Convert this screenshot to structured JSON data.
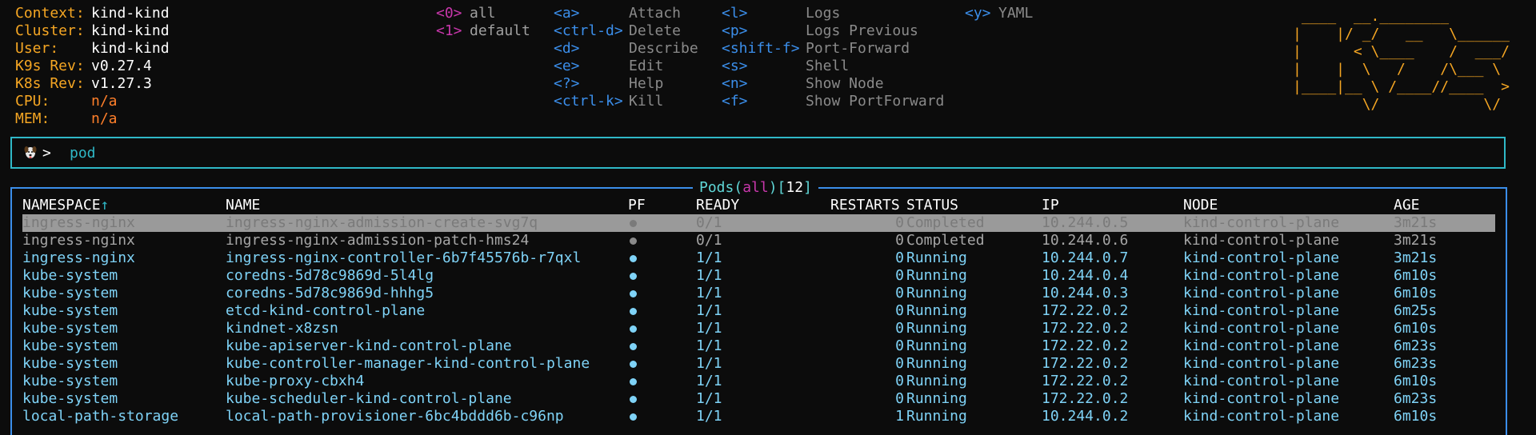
{
  "info": [
    {
      "label": "Context:",
      "value": "kind-kind",
      "na": false
    },
    {
      "label": "Cluster:",
      "value": "kind-kind",
      "na": false
    },
    {
      "label": "User:",
      "value": "kind-kind",
      "na": false
    },
    {
      "label": "K9s Rev:",
      "value": "v0.27.4",
      "na": false
    },
    {
      "label": "K8s Rev:",
      "value": "v1.27.3",
      "na": false
    },
    {
      "label": "CPU:",
      "value": "n/a",
      "na": true
    },
    {
      "label": "MEM:",
      "value": "n/a",
      "na": true
    }
  ],
  "namespaces": [
    {
      "key": "<0>",
      "name": "all"
    },
    {
      "key": "<1>",
      "name": "default"
    }
  ],
  "shortcuts": {
    "col1": [
      {
        "key": "<a>",
        "desc": "Attach"
      },
      {
        "key": "<ctrl-d>",
        "desc": "Delete"
      },
      {
        "key": "<d>",
        "desc": "Describe"
      },
      {
        "key": "<e>",
        "desc": "Edit"
      },
      {
        "key": "<?>",
        "desc": "Help"
      },
      {
        "key": "<ctrl-k>",
        "desc": "Kill"
      }
    ],
    "col2": [
      {
        "key": "<l>",
        "desc": "Logs"
      },
      {
        "key": "<p>",
        "desc": "Logs Previous"
      },
      {
        "key": "<shift-f>",
        "desc": "Port-Forward"
      },
      {
        "key": "<s>",
        "desc": "Shell"
      },
      {
        "key": "<n>",
        "desc": "Show Node"
      },
      {
        "key": "<f>",
        "desc": "Show PortForward"
      }
    ],
    "col3": [
      {
        "key": "<y>",
        "desc": "YAML"
      }
    ]
  },
  "logo_lines": [
    " ____  __.________       ",
    "|    |/ _/   __   \\______",
    "|      < \\____    /  ___/",
    "|    |  \\   /    /\\___ \\ ",
    "|____|__ \\ /____//____  >",
    "        \\/            \\/ "
  ],
  "prompt": {
    "arrow": ">",
    "text": "pod",
    "icon": "dog-icon"
  },
  "table": {
    "resource": "Pods",
    "scope": "all",
    "count": "12",
    "headers": {
      "namespace": "NAMESPACE",
      "sort_arrow": "↑",
      "name": "NAME",
      "pf": "PF",
      "ready": "READY",
      "restarts": "RESTARTS",
      "status": "STATUS",
      "ip": "IP",
      "node": "NODE",
      "age": "AGE"
    },
    "rows": [
      {
        "namespace": "ingress-nginx",
        "name": "ingress-nginx-admission-create-svg7q",
        "ready": "0/1",
        "restarts": "0",
        "status": "Completed",
        "ip": "10.244.0.5",
        "node": "kind-control-plane",
        "age": "3m21s"
      },
      {
        "namespace": "ingress-nginx",
        "name": "ingress-nginx-admission-patch-hms24",
        "ready": "0/1",
        "restarts": "0",
        "status": "Completed",
        "ip": "10.244.0.6",
        "node": "kind-control-plane",
        "age": "3m21s"
      },
      {
        "namespace": "ingress-nginx",
        "name": "ingress-nginx-controller-6b7f45576b-r7qxl",
        "ready": "1/1",
        "restarts": "0",
        "status": "Running",
        "ip": "10.244.0.7",
        "node": "kind-control-plane",
        "age": "3m21s"
      },
      {
        "namespace": "kube-system",
        "name": "coredns-5d78c9869d-5l4lg",
        "ready": "1/1",
        "restarts": "0",
        "status": "Running",
        "ip": "10.244.0.4",
        "node": "kind-control-plane",
        "age": "6m10s"
      },
      {
        "namespace": "kube-system",
        "name": "coredns-5d78c9869d-hhhg5",
        "ready": "1/1",
        "restarts": "0",
        "status": "Running",
        "ip": "10.244.0.3",
        "node": "kind-control-plane",
        "age": "6m10s"
      },
      {
        "namespace": "kube-system",
        "name": "etcd-kind-control-plane",
        "ready": "1/1",
        "restarts": "0",
        "status": "Running",
        "ip": "172.22.0.2",
        "node": "kind-control-plane",
        "age": "6m25s"
      },
      {
        "namespace": "kube-system",
        "name": "kindnet-x8zsn",
        "ready": "1/1",
        "restarts": "0",
        "status": "Running",
        "ip": "172.22.0.2",
        "node": "kind-control-plane",
        "age": "6m10s"
      },
      {
        "namespace": "kube-system",
        "name": "kube-apiserver-kind-control-plane",
        "ready": "1/1",
        "restarts": "0",
        "status": "Running",
        "ip": "172.22.0.2",
        "node": "kind-control-plane",
        "age": "6m23s"
      },
      {
        "namespace": "kube-system",
        "name": "kube-controller-manager-kind-control-plane",
        "ready": "1/1",
        "restarts": "0",
        "status": "Running",
        "ip": "172.22.0.2",
        "node": "kind-control-plane",
        "age": "6m23s"
      },
      {
        "namespace": "kube-system",
        "name": "kube-proxy-cbxh4",
        "ready": "1/1",
        "restarts": "0",
        "status": "Running",
        "ip": "172.22.0.2",
        "node": "kind-control-plane",
        "age": "6m10s"
      },
      {
        "namespace": "kube-system",
        "name": "kube-scheduler-kind-control-plane",
        "ready": "1/1",
        "restarts": "0",
        "status": "Running",
        "ip": "172.22.0.2",
        "node": "kind-control-plane",
        "age": "6m23s"
      },
      {
        "namespace": "local-path-storage",
        "name": "local-path-provisioner-6bc4bddd6b-c96np",
        "ready": "1/1",
        "restarts": "1",
        "status": "Running",
        "ip": "10.244.0.2",
        "node": "kind-control-plane",
        "age": "6m10s"
      }
    ]
  },
  "colors": {
    "background": "#0c0c0c",
    "label": "#f5a623",
    "accent_cyan": "#2fb8c7",
    "frame_blue": "#3b8eea",
    "ns_key": "#c837ab",
    "running_row": "#7fd3f7",
    "completed_row": "#a6a6a6",
    "selected_bg": "#9a9a9a"
  }
}
